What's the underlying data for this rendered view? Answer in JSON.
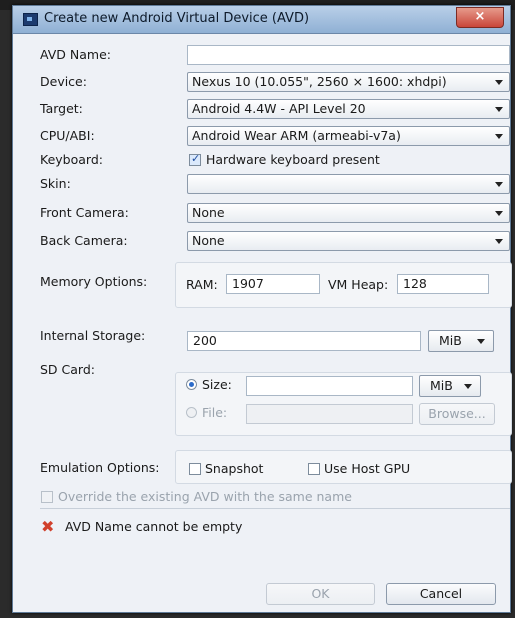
{
  "window": {
    "title": "Create new Android Virtual Device (AVD)",
    "close_label": "×"
  },
  "form": {
    "avd_name": {
      "label": "AVD Name:",
      "value": ""
    },
    "device": {
      "label": "Device:",
      "value": "Nexus 10 (10.055\", 2560 × 1600: xhdpi)"
    },
    "target": {
      "label": "Target:",
      "value": "Android 4.4W - API Level 20"
    },
    "cpu_abi": {
      "label": "CPU/ABI:",
      "value": "Android Wear ARM (armeabi-v7a)"
    },
    "keyboard": {
      "label": "Keyboard:",
      "checkbox_label": "Hardware keyboard present",
      "checked": true
    },
    "skin": {
      "label": "Skin:",
      "value": ""
    },
    "front_camera": {
      "label": "Front Camera:",
      "value": "None"
    },
    "back_camera": {
      "label": "Back Camera:",
      "value": "None"
    },
    "memory": {
      "label": "Memory Options:",
      "ram_label": "RAM:",
      "ram_value": "1907",
      "vm_heap_label": "VM Heap:",
      "vm_heap_value": "128"
    },
    "internal_storage": {
      "label": "Internal Storage:",
      "value": "200",
      "unit": "MiB"
    },
    "sd_card": {
      "label": "SD Card:",
      "size_label": "Size:",
      "size_value": "",
      "size_unit": "MiB",
      "file_label": "File:",
      "file_value": "",
      "browse_label": "Browse..."
    },
    "emulation": {
      "label": "Emulation Options:",
      "snapshot_label": "Snapshot",
      "host_gpu_label": "Use Host GPU"
    },
    "override_label": "Override the existing AVD with the same name"
  },
  "status": {
    "error_icon": "error-x-icon",
    "error_color": "#d0402c",
    "message": "AVD Name cannot be empty"
  },
  "buttons": {
    "ok": "OK",
    "cancel": "Cancel"
  }
}
